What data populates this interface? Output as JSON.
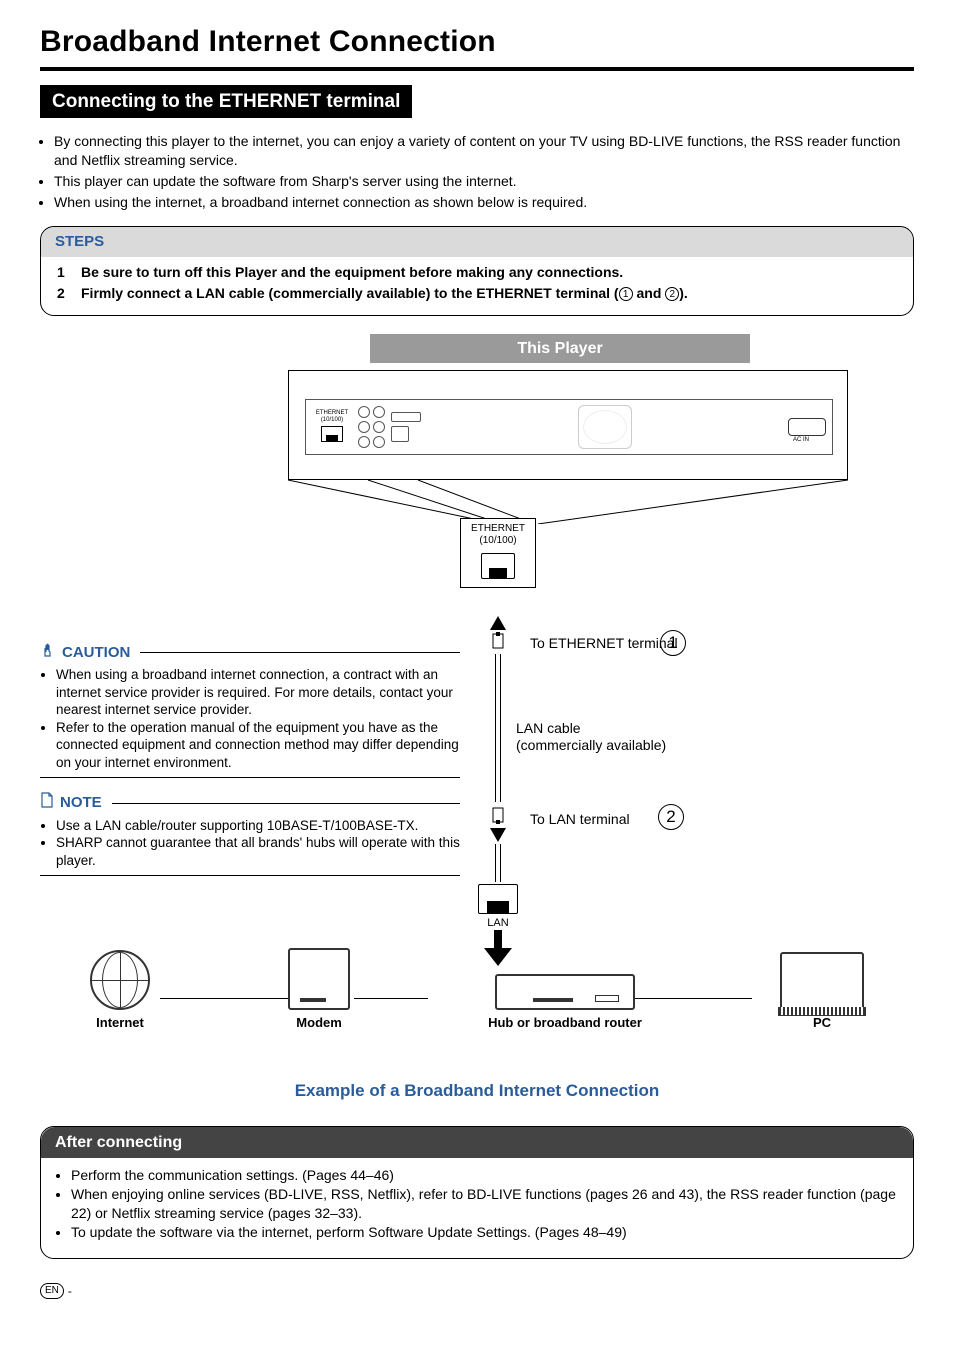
{
  "page_title": "Broadband Internet Connection",
  "section_title": "Connecting to the ETHERNET terminal",
  "intro_bullets": [
    "By connecting this player to the internet, you can enjoy a variety of content on your TV using BD-LIVE functions, the RSS reader function and Netflix streaming service.",
    "This player can update the software from Sharp's server using the internet.",
    "When using the internet, a broadband internet connection as shown below is required."
  ],
  "steps_head": "STEPS",
  "steps": [
    {
      "n": "1",
      "text": "Be sure to turn off this Player and the equipment before making any connections."
    },
    {
      "n": "2",
      "text_pre": "Firmly connect a LAN cable (commercially available) to the ETHERNET terminal (",
      "text_post": ").",
      "c1": "1",
      "and": " and ",
      "c2": "2"
    }
  ],
  "this_player_label": "This Player",
  "ethernet_box": {
    "line1": "ETHERNET",
    "line2": "(10/100)"
  },
  "to_eth_label": "To ETHERNET terminal",
  "to_lan_label": "To LAN terminal",
  "lan_cable_label_l1": "LAN cable",
  "lan_cable_label_l2": "(commercially available)",
  "lan_box_label": "LAN",
  "devices": {
    "internet": "Internet",
    "modem": "Modem",
    "hub": "Hub or broadband router",
    "pc": "PC"
  },
  "example_label": "Example of a Broadband Internet Connection",
  "caution_head": "CAUTION",
  "caution_bullets": [
    "When using a broadband internet connection, a contract with an internet service provider is required. For more details, contact your nearest internet service provider.",
    "Refer to the operation manual of the equipment you have as the connected equipment and connection method may differ depending on your internet environment."
  ],
  "note_head": "NOTE",
  "note_bullets": [
    "Use a LAN cable/router supporting 10BASE-T/100BASE-TX.",
    "SHARP cannot guarantee that all brands' hubs will operate with this player."
  ],
  "after_head": "After connecting",
  "after_bullets": [
    "Perform the communication settings. (Pages 44–46)",
    "When enjoying online services (BD-LIVE, RSS, Netflix), refer to BD-LIVE functions (pages 26 and 43), the RSS reader function (page 22) or Netflix streaming service (pages 32–33).",
    "To update the software via the internet, perform Software Update Settings. (Pages 48–49)"
  ],
  "footer_en": "EN",
  "footer_dash": " - "
}
